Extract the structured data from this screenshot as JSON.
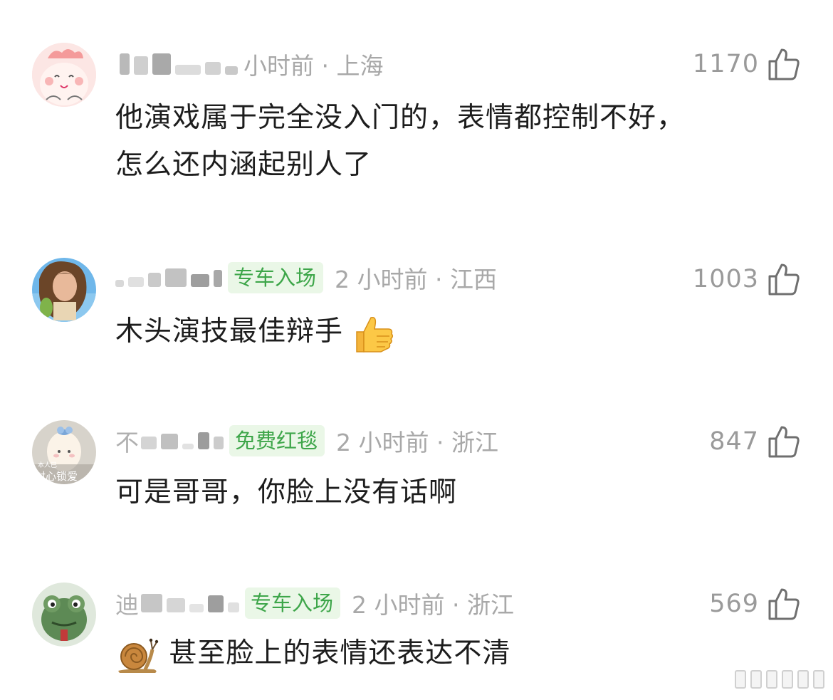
{
  "comments": [
    {
      "name": "测·",
      "badge": "",
      "time_loc": "小时前 · 上海",
      "likes": "1170",
      "text_line1": "他演戏属于完全没入门的，表情都控制不好，",
      "text_line2": "怎么还内涵起别人了"
    },
    {
      "name": "",
      "badge": "专车入场",
      "time_loc": "2 小时前 · 江西",
      "likes": "1003",
      "text": "木头演技最佳辩手"
    },
    {
      "name": "不",
      "badge": "免费红毯",
      "time_loc": "2 小时前 · 浙江",
      "likes": "847",
      "text": "可是哥哥，你脸上没有话啊",
      "avatar_caption_top": "本人已",
      "avatar_caption": "封心锁爱"
    },
    {
      "name": "迪",
      "badge": "专车入场",
      "time_loc": "2 小时前 · 浙江",
      "likes": "569",
      "text": "甚至脸上的表情还表达不清"
    }
  ],
  "icons": {
    "like": "thumbs-up-outline-icon",
    "emoji_thumb": "thumbs-up-emoji",
    "emoji_snail": "snail-emoji"
  },
  "colors": {
    "badge_bg": "#eaf7e7",
    "badge_text": "#3ea64a",
    "meta_text": "#a8a8a8",
    "body_text": "#1d1d1d"
  }
}
